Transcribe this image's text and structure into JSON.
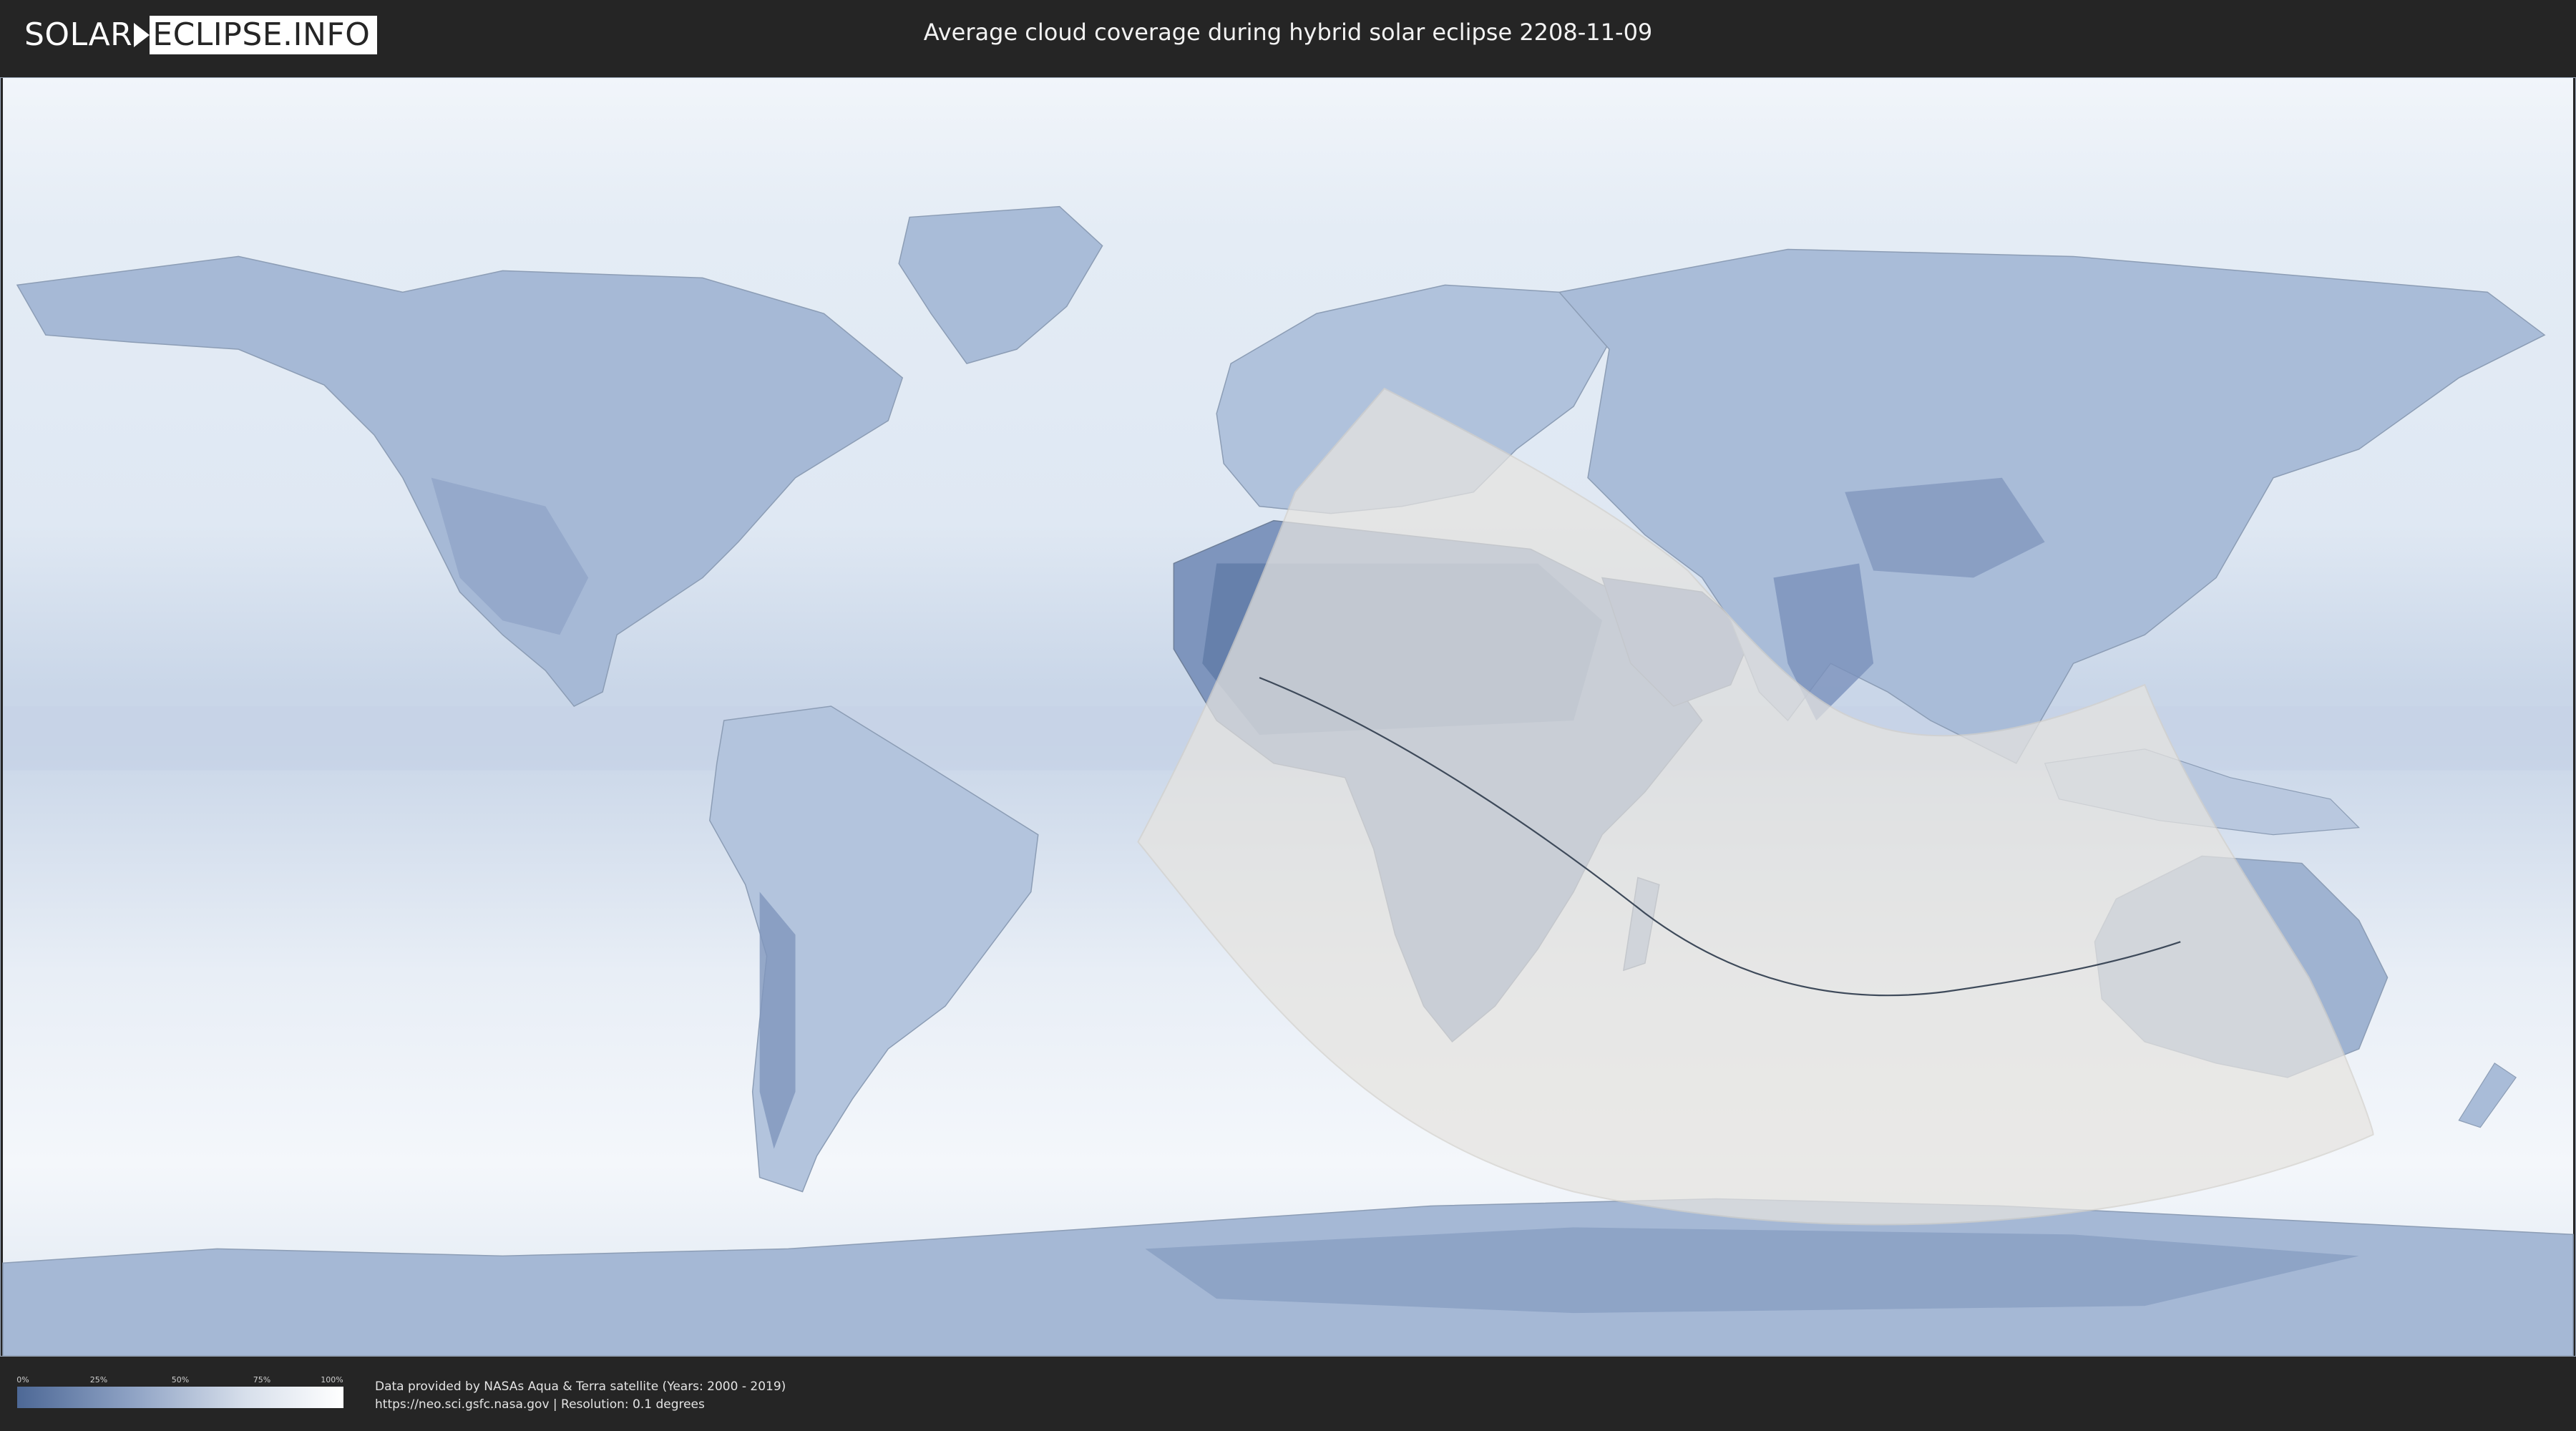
{
  "logo": {
    "left": "SOLAR",
    "right": "ECLIPSE.INFO"
  },
  "title": "Average cloud coverage during hybrid solar eclipse 2208-11-09",
  "legend": {
    "ticks": [
      "0%",
      "25%",
      "50%",
      "75%",
      "100%"
    ],
    "colors": [
      "#4d6896",
      "#8ea2c4",
      "#d7dfeb",
      "#ffffff"
    ]
  },
  "credits": {
    "line1": "Data provided by NASAs Aqua & Terra satellite (Years: 2000 - 2019)",
    "line2": "https://neo.sci.gsfc.nasa.gov | Resolution: 0.1 degrees"
  },
  "map": {
    "ocean_color": "#e6edf5",
    "land_cloudy_color": "#9fb3d1",
    "land_clear_color": "#6e86ae",
    "eclipse_zone_color": "#e6e4e0",
    "path_line_color": "#3e4a5a"
  }
}
